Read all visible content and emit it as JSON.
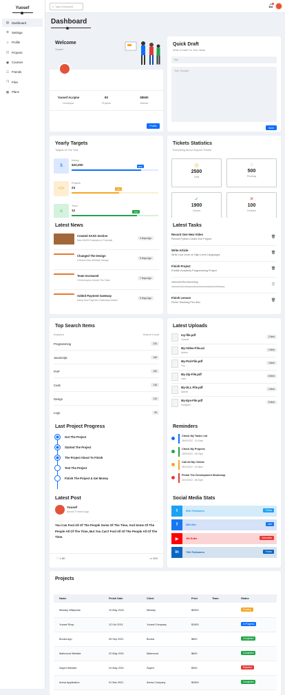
{
  "brand": "Yuosef",
  "nav": [
    {
      "label": "Dashboard",
      "icon": "▤"
    },
    {
      "label": "Settings",
      "icon": "⚙"
    },
    {
      "label": "Profile",
      "icon": "☺"
    },
    {
      "label": "Projects",
      "icon": "◫"
    },
    {
      "label": "Courses",
      "icon": "▣"
    },
    {
      "label": "Friends",
      "icon": "☷"
    },
    {
      "label": "Files",
      "icon": "❐"
    },
    {
      "label": "Plans",
      "icon": "▦"
    }
  ],
  "search": {
    "placeholder": "Type A Keyword"
  },
  "page_title": "Dashboard",
  "welcome": {
    "title": "Welcome",
    "name": "Yuosef",
    "stats": [
      {
        "value": "Yuosef ALnjme",
        "label": "Developer"
      },
      {
        "value": "80",
        "label": "Projects"
      },
      {
        "value": "$8500",
        "label": "Earned"
      }
    ],
    "button": "Profile"
  },
  "draft": {
    "title": "Quick Draft",
    "subtitle": "Write A Draft For Your Ideas",
    "title_ph": "Title",
    "body_ph": "Your Thought",
    "button": "Save"
  },
  "targets": {
    "title": "Yearly Targets",
    "subtitle": "Targets Of The Year",
    "items": [
      {
        "label": "Money",
        "value": "$20,000",
        "pct": "80%",
        "fill": 0.8,
        "color": "#0d6efd",
        "bg": "#dbe8ff"
      },
      {
        "label": "Projects",
        "value": "24",
        "pct": "55%",
        "fill": 0.55,
        "color": "#f5a623",
        "bg": "#fdeed3"
      },
      {
        "label": "Team",
        "value": "12",
        "pct": "75%",
        "fill": 0.75,
        "color": "#22a34a",
        "bg": "#d4f2dd"
      }
    ]
  },
  "tickets": {
    "title": "Tickets Statistics",
    "subtitle": "Everything About Support Tickets",
    "items": [
      {
        "value": "2500",
        "label": "Total",
        "icon": "◷",
        "color": "#f5a623"
      },
      {
        "value": "500",
        "label": "Pending",
        "icon": "◌",
        "color": "#0d6efd"
      },
      {
        "value": "1900",
        "label": "Closed",
        "icon": "✓",
        "color": "#22a34a"
      },
      {
        "value": "100",
        "label": "Deleted",
        "icon": "✕",
        "color": "#e53935"
      }
    ]
  },
  "news": {
    "title": "Latest News",
    "items": [
      {
        "title": "Created SASS Section",
        "desc": "New SASS Examples & Tutorials",
        "time": "3 Days Ago"
      },
      {
        "title": "Changed The Design",
        "desc": "A Brand New Website Design",
        "time": "5 Days Ago"
      },
      {
        "title": "Team Increased",
        "desc": "3 Developers Joined The Team",
        "time": "7 Days Ago"
      },
      {
        "title": "Added Payment Gateway",
        "desc": "Many New Payment Gateways Added",
        "time": "9 Days Ago"
      }
    ]
  },
  "tasks": {
    "title": "Latest Tasks",
    "items": [
      {
        "title": "Record One New Video",
        "desc": "Record Python Create Exe Project",
        "done": false
      },
      {
        "title": "Write Article",
        "desc": "Write Low Level vs High Level Languages",
        "done": false
      },
      {
        "title": "Finish Project",
        "desc": "Publish Academy Programming Project",
        "done": false
      },
      {
        "title": "Attend The Meeting",
        "desc": "Attend The Project Business Analysis Meeting",
        "done": true
      },
      {
        "title": "Finish Lesson",
        "desc": "Finish Teaching Flex Box",
        "done": false
      }
    ]
  },
  "search_items": {
    "title": "Top Search Items",
    "col1": "Keyword",
    "col2": "Search Count",
    "rows": [
      {
        "k": "Programming",
        "c": "220"
      },
      {
        "k": "JavaScript",
        "c": "160"
      },
      {
        "k": "PHP",
        "c": "160"
      },
      {
        "k": "Code",
        "c": "145"
      },
      {
        "k": "Design",
        "c": "110"
      },
      {
        "k": "Logo",
        "c": "95"
      }
    ]
  },
  "uploads": {
    "title": "Latest Uploads",
    "items": [
      {
        "name": "my-file.pdf",
        "by": "Yuosef",
        "size": "2.9mb"
      },
      {
        "name": "My-Video-File.avi",
        "by": "Admin",
        "size": "4.9mb"
      },
      {
        "name": "My-Psd-File.pdf",
        "by": "You",
        "size": "4.5mb"
      },
      {
        "name": "My-Zip-File.pdf",
        "by": "User",
        "size": "8.9mb"
      },
      {
        "name": "My-DLL-File.pdf",
        "by": "Admin",
        "size": "4.9mb"
      },
      {
        "name": "My-Eps-File.pdf",
        "by": "Designer",
        "size": "8.9mb"
      }
    ]
  },
  "progress": {
    "title": "Last Project Progress",
    "steps": [
      "Got The Project",
      "Started The Project",
      "The Project About To Finish",
      "Test The Project",
      "Finish The Project & Get Money"
    ],
    "done": 3
  },
  "reminders": {
    "title": "Reminders",
    "items": [
      {
        "title": "Check My Tasks List",
        "date": "28/09/2022 - 12:00am",
        "color": "#0d6efd"
      },
      {
        "title": "Check My Projects",
        "date": "26/09/2022 - 05:00pm",
        "color": "#22a34a"
      },
      {
        "title": "Call All My Clients",
        "date": "05/11/2022 - 10:00pm",
        "color": "#f5a623"
      },
      {
        "title": "Finish The Development Workshop",
        "date": "20/10/2022 - 08:00pm",
        "color": "#e53935"
      }
    ]
  },
  "post": {
    "title": "Latest Post",
    "author": "Yuosef",
    "time": "About 3 Hours Ago",
    "text": "You Can Fool All Of The People Some Of The Time, And Some Of The People All Of The Time, But You Can't Fool All Of The People All Of The Time.",
    "likes": "1.8K",
    "comments": "500"
  },
  "social": {
    "title": "Social Media Stats",
    "items": [
      {
        "icon": "t",
        "label": "90K Followers",
        "btn": "Follow",
        "color": "#1da1f2",
        "bg": "#d5ebfa",
        "btnColor": "#1da1f2"
      },
      {
        "icon": "f",
        "label": "2M Like",
        "btn": "Like",
        "color": "#1877f2",
        "bg": "#d5e2f7",
        "btnColor": "#1877f2"
      },
      {
        "icon": "▶",
        "label": "1M Subs",
        "btn": "Subscribe",
        "color": "#ff0000",
        "bg": "#fbd5d5",
        "btnColor": "#e53935"
      },
      {
        "icon": "in",
        "label": "70K Followers",
        "btn": "Follow",
        "color": "#0a66c2",
        "bg": "#d5e2ef",
        "btnColor": "#0a66c2"
      }
    ]
  },
  "projects": {
    "title": "Projects",
    "headers": [
      "Name",
      "Finish Date",
      "Client",
      "Price",
      "Team",
      "Status"
    ],
    "rows": [
      {
        "name": "Ministry Wikipedia",
        "date": "10 May 2022",
        "client": "Ministry",
        "price": "$5300",
        "status": "Pending",
        "color": "#f5a623"
      },
      {
        "name": "Yuosef Shop",
        "date": "12 Oct 2021",
        "client": "Yuosef Company",
        "price": "$1500",
        "status": "In Progress",
        "color": "#0d6efd"
      },
      {
        "name": "Bouba App",
        "date": "05 Sep 2021",
        "client": "Bouba",
        "price": "$800",
        "status": "Completed",
        "color": "#22a34a"
      },
      {
        "name": "Mahmoud Website",
        "date": "22 May 2021",
        "client": "Mahmoud",
        "price": "$600",
        "status": "Completed",
        "color": "#22a34a"
      },
      {
        "name": "Sayed Website",
        "date": "24 May 2021",
        "client": "Sayed",
        "price": "$300",
        "status": "Rejected",
        "color": "#e53935"
      },
      {
        "name": "Arena Application",
        "date": "01 Mar 2021",
        "client": "Arena Company",
        "price": "$2600",
        "status": "Completed",
        "color": "#22a34a"
      }
    ]
  }
}
